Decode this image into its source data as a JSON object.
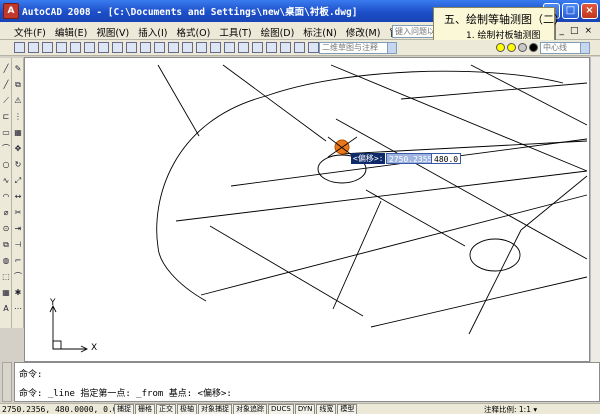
{
  "window": {
    "app_icon": "autocad-app-icon",
    "title": "AutoCAD 2008 - [C:\\Documents and Settings\\new\\桌面\\衬板.dwg]",
    "controls": [
      "_",
      "□",
      "×"
    ]
  },
  "menu": {
    "items": [
      "文件(F)",
      "编辑(E)",
      "视图(V)",
      "插入(I)",
      "格式(O)",
      "工具(T)",
      "绘图(D)",
      "标注(N)",
      "修改(M)",
      "窗口(W)",
      "帮助(H)"
    ],
    "help_input_placeholder": "键入问题以获取帮助",
    "mdi_controls": [
      "_",
      "□",
      "×"
    ]
  },
  "overlay": {
    "title": "五、绘制等轴测图（二）",
    "subtitle": "1. 绘制衬板轴测图"
  },
  "toolbar": {
    "workspace": "二维草图与注释",
    "layer_control": "中心线",
    "color_dots": [
      "#ffff00",
      "#ffff00",
      "#c8c8c8",
      "#000000"
    ]
  },
  "drawing": {
    "dynamic_input": {
      "prompt": "<偏移>:",
      "x_value": "2750.2355",
      "y_value": "480.0"
    },
    "ucs": {
      "x_label": "X",
      "y_label": "Y"
    }
  },
  "command": {
    "line1": "命令:",
    "line2": "命令: _line 指定第一点: _from 基点: <偏移>:"
  },
  "status": {
    "coordinates": "2750.2356, 480.0000, 0.0000",
    "toggles": [
      "捕捉",
      "栅格",
      "正交",
      "极轴",
      "对象捕捉",
      "对象追踪",
      "DUCS",
      "DYN",
      "线宽",
      "模型"
    ],
    "annotation_scale": "注释比例: 1:1 ▾"
  }
}
